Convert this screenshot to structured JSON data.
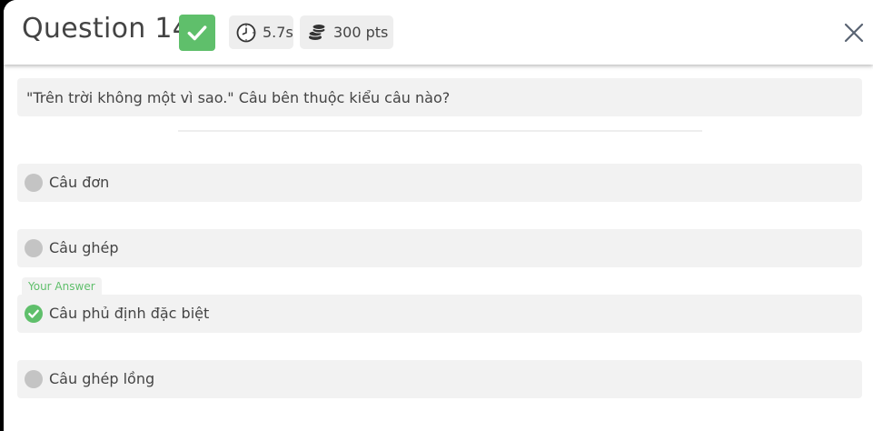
{
  "header": {
    "title": "Question 14",
    "status_icon": "check-icon",
    "time_label": "5.7s",
    "time_icon": "clock-icon",
    "points_label": "300 pts",
    "points_icon": "coins-icon",
    "close_icon": "close-icon"
  },
  "question": {
    "text": "\"Trên trời không một vì sao.\" Câu bên thuộc kiểu câu nào?"
  },
  "options": [
    {
      "label": "Câu đơn",
      "state": "unselected"
    },
    {
      "label": "Câu ghép",
      "state": "unselected"
    },
    {
      "label": "Câu phủ định đặc biệt",
      "state": "correct",
      "your_answer_tag": "Your Answer"
    },
    {
      "label": "Câu ghép lồng",
      "state": "unselected"
    }
  ],
  "colors": {
    "correct": "#5fbf6b",
    "chip_bg": "#eeeeee",
    "option_bg": "#f2f2f2",
    "radio_unselected": "#c4c4c4",
    "text": "#444444"
  }
}
